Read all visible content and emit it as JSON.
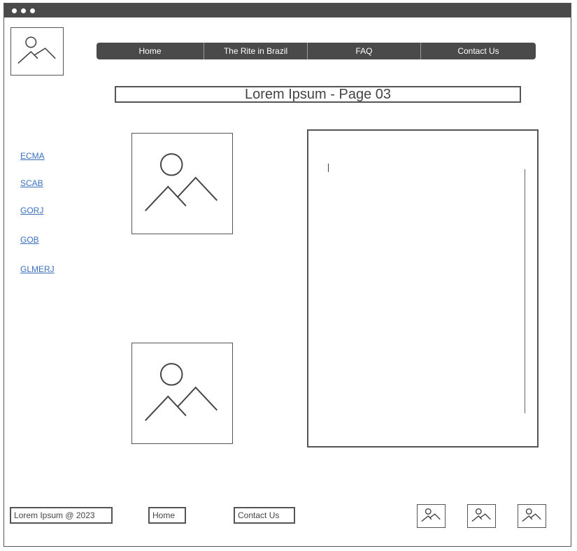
{
  "nav": {
    "items": [
      {
        "label": "Home"
      },
      {
        "label": "The Rite in Brazil"
      },
      {
        "label": "FAQ"
      },
      {
        "label": "Contact Us"
      }
    ]
  },
  "page": {
    "title": "Lorem Ipsum - Page 03"
  },
  "sidebar": {
    "links": [
      {
        "label": "ECMA"
      },
      {
        "label": "SCAB"
      },
      {
        "label": "GORJ"
      },
      {
        "label": "GOB"
      },
      {
        "label": "GLMERJ"
      }
    ]
  },
  "footer": {
    "copyright": "Lorem Ipsum @ 2023",
    "home_label": "Home",
    "contact_label": "Contact Us",
    "icons": [
      "image-icon",
      "image-icon",
      "image-icon"
    ]
  },
  "colors": {
    "nav_bg": "#4a4a4a",
    "link": "#3a6fc0",
    "border": "#555555"
  }
}
